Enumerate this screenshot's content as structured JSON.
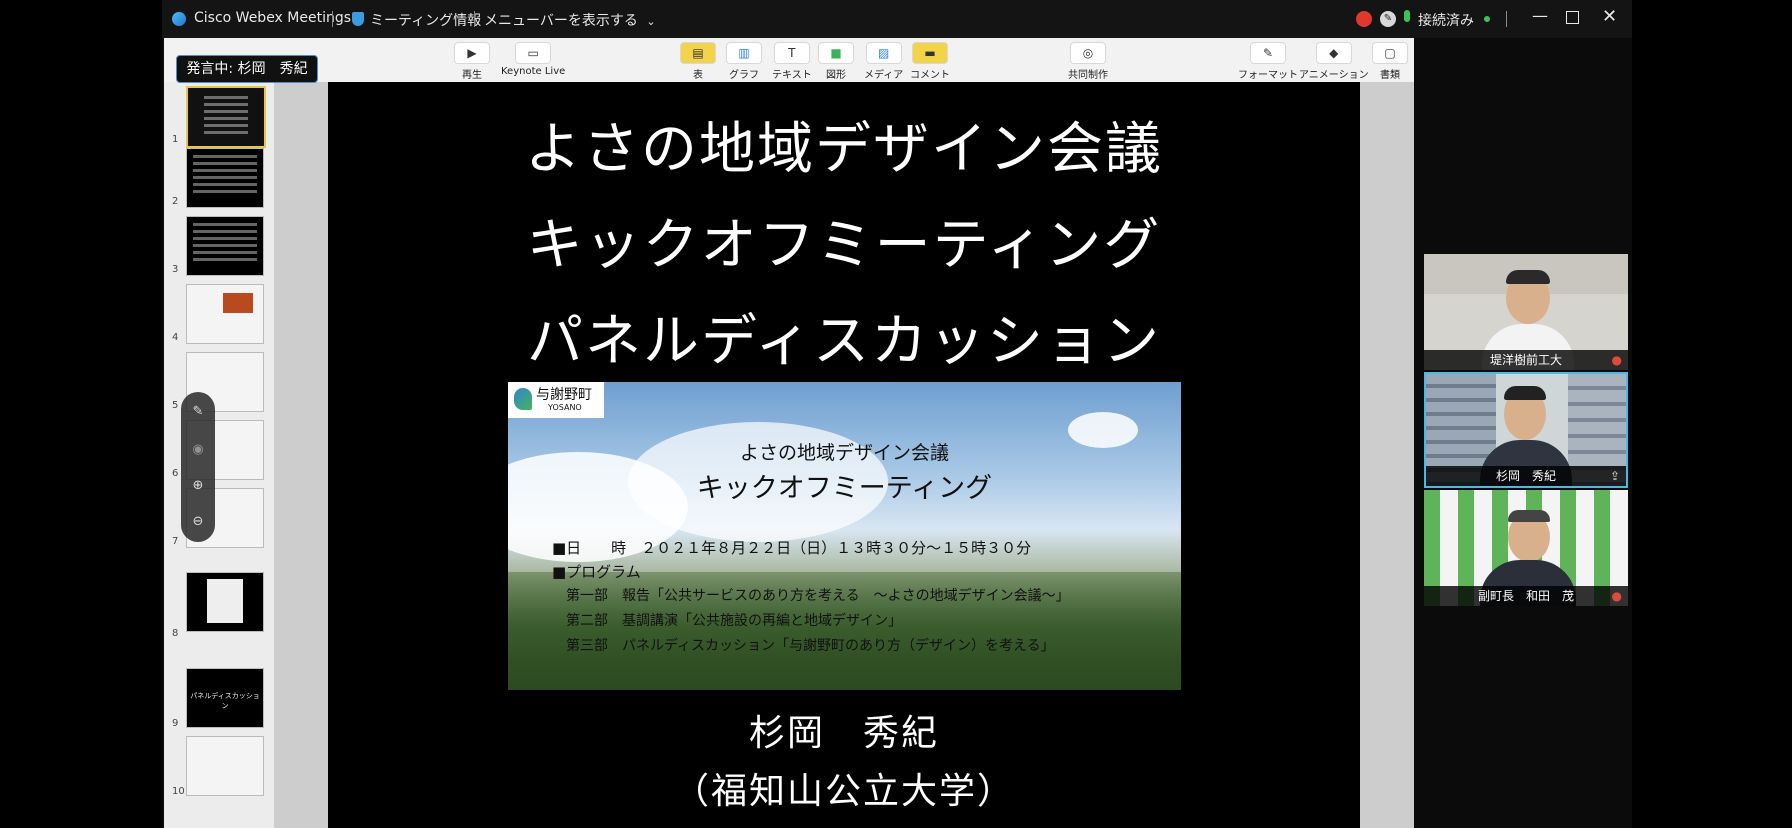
{
  "titlebar": {
    "app_name": "Cisco Webex Meetings",
    "meeting_info": "ミーティング情報",
    "show_menubar": "メニューバーを表示する",
    "status": "接続済み"
  },
  "toolbar": {
    "play": "再生",
    "keynote_live": "Keynote Live",
    "table": "表",
    "chart": "グラフ",
    "text": "テキスト",
    "shape": "図形",
    "media": "メディア",
    "comment": "コメント",
    "collaborate": "共同制作",
    "format": "フォーマット",
    "animate": "アニメーション",
    "document": "書類"
  },
  "presenter_tag": "発言中: 杉岡　秀紀",
  "slides": [
    {
      "num": "1"
    },
    {
      "num": "2"
    },
    {
      "num": "3"
    },
    {
      "num": "4"
    },
    {
      "num": "5"
    },
    {
      "num": "6"
    },
    {
      "num": "7"
    },
    {
      "num": "8"
    },
    {
      "num": "9",
      "text": "パネルディスカッション"
    },
    {
      "num": "10"
    }
  ],
  "slide": {
    "title_line1": "よさの地域デザイン会議",
    "title_line2": "キックオフミーティング",
    "title_line3": "パネルディスカッション",
    "photo": {
      "logo_text": "与謝野町",
      "logo_sub": "YOSANO",
      "heading1": "よさの地域デザイン会議",
      "heading2": "キックオフミーティング",
      "date_line": "■日　　時　２０２１年８月２２日（日）１３時３０分～１５時３０分",
      "program_label": "■プログラム",
      "part1": "第一部　報告「公共サービスのあり方を考える　～よさの地域デザイン会議～」",
      "part2": "第二部　基調講演「公共施設の再編と地域デザイン」",
      "part3": "第三部　パネルディスカッション「与謝野町のあり方（デザイン）を考える」"
    },
    "speaker": "杉岡　秀紀",
    "affiliation": "（福知山公立大学）"
  },
  "participants": [
    {
      "name": "堤洋樹前工大"
    },
    {
      "name": "杉岡　秀紀"
    },
    {
      "name": "副町長　和田　茂"
    }
  ],
  "colors": {
    "accent": "#4ab8e8",
    "record": "#e0392b",
    "connected": "#3cc25a"
  }
}
